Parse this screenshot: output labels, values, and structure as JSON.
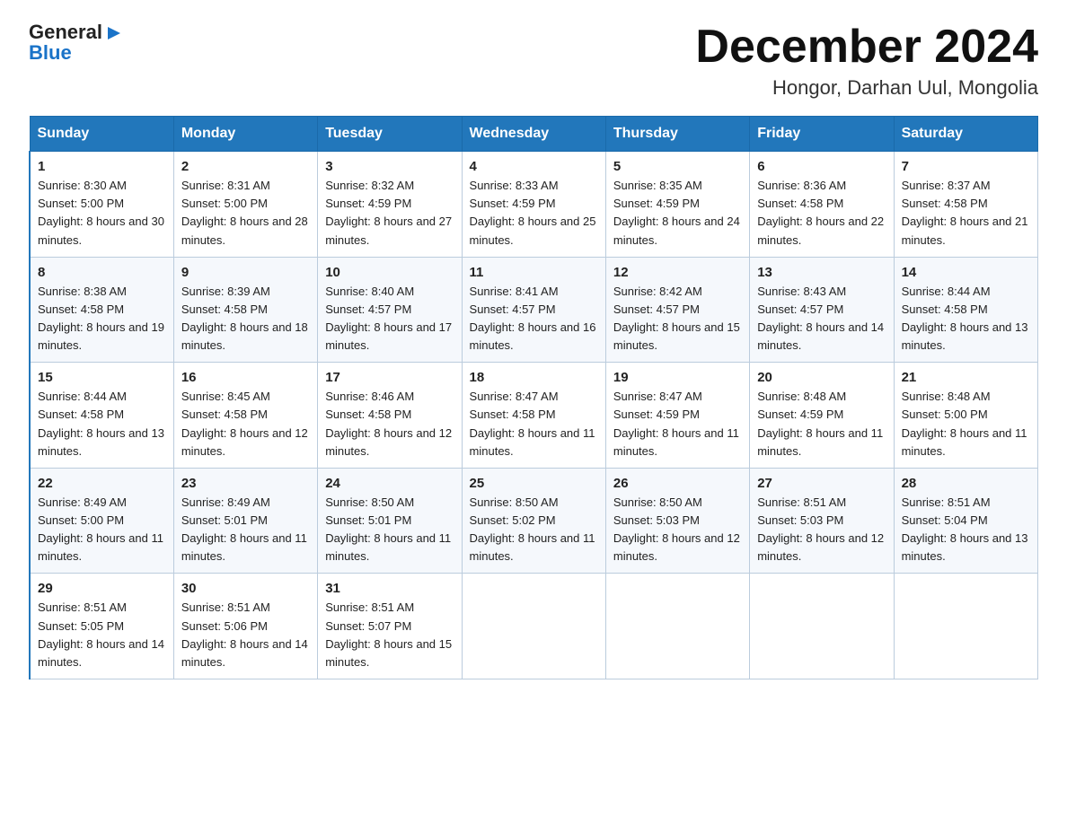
{
  "logo": {
    "line1": "General",
    "triangle": "▶",
    "line2": "Blue"
  },
  "title": "December 2024",
  "location": "Hongor, Darhan Uul, Mongolia",
  "weekdays": [
    "Sunday",
    "Monday",
    "Tuesday",
    "Wednesday",
    "Thursday",
    "Friday",
    "Saturday"
  ],
  "weeks": [
    [
      {
        "day": "1",
        "sunrise": "8:30 AM",
        "sunset": "5:00 PM",
        "daylight": "8 hours and 30 minutes."
      },
      {
        "day": "2",
        "sunrise": "8:31 AM",
        "sunset": "5:00 PM",
        "daylight": "8 hours and 28 minutes."
      },
      {
        "day": "3",
        "sunrise": "8:32 AM",
        "sunset": "4:59 PM",
        "daylight": "8 hours and 27 minutes."
      },
      {
        "day": "4",
        "sunrise": "8:33 AM",
        "sunset": "4:59 PM",
        "daylight": "8 hours and 25 minutes."
      },
      {
        "day": "5",
        "sunrise": "8:35 AM",
        "sunset": "4:59 PM",
        "daylight": "8 hours and 24 minutes."
      },
      {
        "day": "6",
        "sunrise": "8:36 AM",
        "sunset": "4:58 PM",
        "daylight": "8 hours and 22 minutes."
      },
      {
        "day": "7",
        "sunrise": "8:37 AM",
        "sunset": "4:58 PM",
        "daylight": "8 hours and 21 minutes."
      }
    ],
    [
      {
        "day": "8",
        "sunrise": "8:38 AM",
        "sunset": "4:58 PM",
        "daylight": "8 hours and 19 minutes."
      },
      {
        "day": "9",
        "sunrise": "8:39 AM",
        "sunset": "4:58 PM",
        "daylight": "8 hours and 18 minutes."
      },
      {
        "day": "10",
        "sunrise": "8:40 AM",
        "sunset": "4:57 PM",
        "daylight": "8 hours and 17 minutes."
      },
      {
        "day": "11",
        "sunrise": "8:41 AM",
        "sunset": "4:57 PM",
        "daylight": "8 hours and 16 minutes."
      },
      {
        "day": "12",
        "sunrise": "8:42 AM",
        "sunset": "4:57 PM",
        "daylight": "8 hours and 15 minutes."
      },
      {
        "day": "13",
        "sunrise": "8:43 AM",
        "sunset": "4:57 PM",
        "daylight": "8 hours and 14 minutes."
      },
      {
        "day": "14",
        "sunrise": "8:44 AM",
        "sunset": "4:58 PM",
        "daylight": "8 hours and 13 minutes."
      }
    ],
    [
      {
        "day": "15",
        "sunrise": "8:44 AM",
        "sunset": "4:58 PM",
        "daylight": "8 hours and 13 minutes."
      },
      {
        "day": "16",
        "sunrise": "8:45 AM",
        "sunset": "4:58 PM",
        "daylight": "8 hours and 12 minutes."
      },
      {
        "day": "17",
        "sunrise": "8:46 AM",
        "sunset": "4:58 PM",
        "daylight": "8 hours and 12 minutes."
      },
      {
        "day": "18",
        "sunrise": "8:47 AM",
        "sunset": "4:58 PM",
        "daylight": "8 hours and 11 minutes."
      },
      {
        "day": "19",
        "sunrise": "8:47 AM",
        "sunset": "4:59 PM",
        "daylight": "8 hours and 11 minutes."
      },
      {
        "day": "20",
        "sunrise": "8:48 AM",
        "sunset": "4:59 PM",
        "daylight": "8 hours and 11 minutes."
      },
      {
        "day": "21",
        "sunrise": "8:48 AM",
        "sunset": "5:00 PM",
        "daylight": "8 hours and 11 minutes."
      }
    ],
    [
      {
        "day": "22",
        "sunrise": "8:49 AM",
        "sunset": "5:00 PM",
        "daylight": "8 hours and 11 minutes."
      },
      {
        "day": "23",
        "sunrise": "8:49 AM",
        "sunset": "5:01 PM",
        "daylight": "8 hours and 11 minutes."
      },
      {
        "day": "24",
        "sunrise": "8:50 AM",
        "sunset": "5:01 PM",
        "daylight": "8 hours and 11 minutes."
      },
      {
        "day": "25",
        "sunrise": "8:50 AM",
        "sunset": "5:02 PM",
        "daylight": "8 hours and 11 minutes."
      },
      {
        "day": "26",
        "sunrise": "8:50 AM",
        "sunset": "5:03 PM",
        "daylight": "8 hours and 12 minutes."
      },
      {
        "day": "27",
        "sunrise": "8:51 AM",
        "sunset": "5:03 PM",
        "daylight": "8 hours and 12 minutes."
      },
      {
        "day": "28",
        "sunrise": "8:51 AM",
        "sunset": "5:04 PM",
        "daylight": "8 hours and 13 minutes."
      }
    ],
    [
      {
        "day": "29",
        "sunrise": "8:51 AM",
        "sunset": "5:05 PM",
        "daylight": "8 hours and 14 minutes."
      },
      {
        "day": "30",
        "sunrise": "8:51 AM",
        "sunset": "5:06 PM",
        "daylight": "8 hours and 14 minutes."
      },
      {
        "day": "31",
        "sunrise": "8:51 AM",
        "sunset": "5:07 PM",
        "daylight": "8 hours and 15 minutes."
      },
      null,
      null,
      null,
      null
    ]
  ]
}
